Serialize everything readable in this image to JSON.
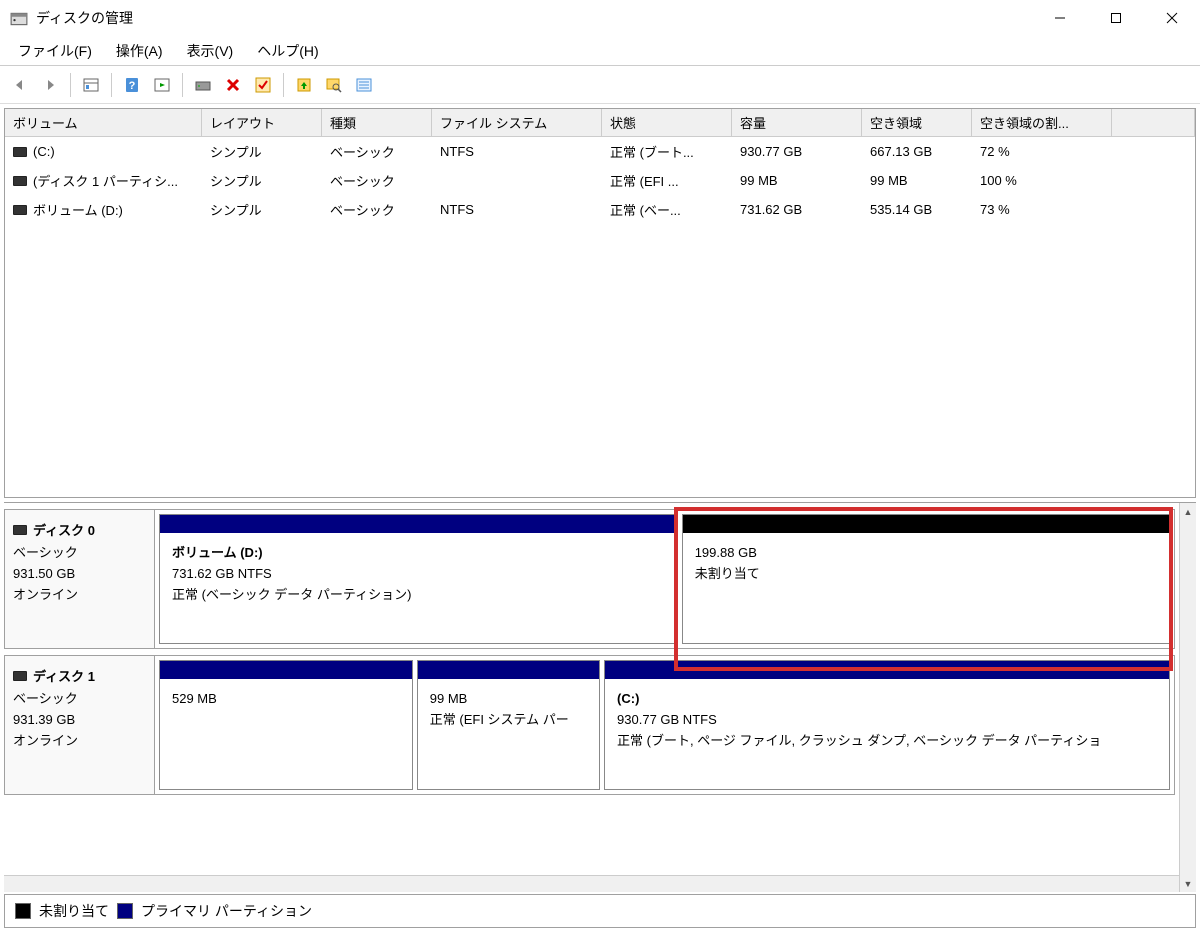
{
  "window": {
    "title": "ディスクの管理"
  },
  "menu": {
    "file": "ファイル(F)",
    "action": "操作(A)",
    "view": "表示(V)",
    "help": "ヘルプ(H)"
  },
  "columns": {
    "volume": "ボリューム",
    "layout": "レイアウト",
    "type": "種類",
    "filesystem": "ファイル システム",
    "status": "状態",
    "capacity": "容量",
    "free": "空き領域",
    "free_pct": "空き領域の割..."
  },
  "volumes": [
    {
      "name": "(C:)",
      "layout": "シンプル",
      "type": "ベーシック",
      "fs": "NTFS",
      "status": "正常 (ブート...",
      "capacity": "930.77 GB",
      "free": "667.13 GB",
      "pct": "72 %"
    },
    {
      "name": "(ディスク 1 パーティシ...",
      "layout": "シンプル",
      "type": "ベーシック",
      "fs": "",
      "status": "正常 (EFI ...",
      "capacity": "99 MB",
      "free": "99 MB",
      "pct": "100 %"
    },
    {
      "name": "ボリューム (D:)",
      "layout": "シンプル",
      "type": "ベーシック",
      "fs": "NTFS",
      "status": "正常 (ベー...",
      "capacity": "731.62 GB",
      "free": "535.14 GB",
      "pct": "73 %"
    }
  ],
  "disks": [
    {
      "name": "ディスク 0",
      "type": "ベーシック",
      "size": "931.50 GB",
      "state": "オンライン",
      "parts": [
        {
          "header": "primary",
          "title": "ボリューム  (D:)",
          "line2": "731.62 GB NTFS",
          "line3": "正常 (ベーシック データ パーティション)",
          "flex": 510
        },
        {
          "header": "unalloc",
          "title": "",
          "line2": "199.88 GB",
          "line3": "未割り当て",
          "flex": 480
        }
      ]
    },
    {
      "name": "ディスク 1",
      "type": "ベーシック",
      "size": "931.39 GB",
      "state": "オンライン",
      "parts": [
        {
          "header": "primary",
          "title": "",
          "line2": "529 MB",
          "line3": "",
          "flex": 250
        },
        {
          "header": "primary",
          "title": "",
          "line2": "99 MB",
          "line3": "正常 (EFI システム パー",
          "flex": 180
        },
        {
          "header": "primary",
          "title": "(C:)",
          "line2": "930.77 GB NTFS",
          "line3": "正常 (ブート, ページ ファイル, クラッシュ ダンプ, ベーシック データ パーティショ",
          "flex": 560
        }
      ]
    }
  ],
  "legend": {
    "unallocated": "未割り当て",
    "primary": "プライマリ パーティション"
  },
  "colors": {
    "primary": "#000080",
    "unallocated": "#000000",
    "highlight": "#d32f2f"
  }
}
